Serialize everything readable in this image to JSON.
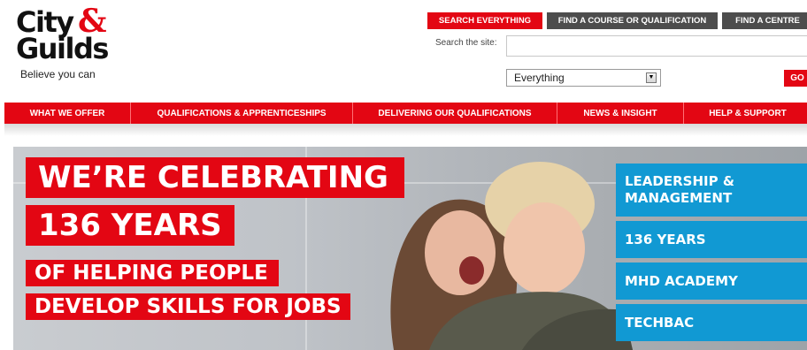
{
  "logo": {
    "line1": "City",
    "amp": "&",
    "line2": "Guilds",
    "tagline": "Believe you can"
  },
  "utility_tabs": [
    {
      "label": "SEARCH EVERYTHING",
      "active": true
    },
    {
      "label": "FIND A COURSE OR QUALIFICATION",
      "active": false
    },
    {
      "label": "FIND A CENTRE",
      "active": false
    }
  ],
  "search": {
    "label": "Search the site:",
    "value": "",
    "scope_selected": "Everything",
    "go_label": "GO"
  },
  "nav": [
    {
      "label": "WHAT WE OFFER"
    },
    {
      "label": "QUALIFICATIONS & APPRENTICESHIPS"
    },
    {
      "label": "DELIVERING OUR QUALIFICATIONS"
    },
    {
      "label": "NEWS & INSIGHT"
    },
    {
      "label": "HELP & SUPPORT"
    }
  ],
  "hero": {
    "line1": "WE’RE CELEBRATING",
    "line2": "136 YEARS",
    "line3": "OF HELPING PEOPLE",
    "line4": "DEVELOP SKILLS FOR JOBS"
  },
  "side_links": [
    {
      "line1": "LEADERSHIP &",
      "line2": "MANAGEMENT"
    },
    {
      "line1": "136 YEARS"
    },
    {
      "line1": "MHD ACADEMY"
    },
    {
      "line1": "TECHBAC"
    }
  ],
  "colors": {
    "brand_red": "#e30613",
    "nav_grey": "#4d4d4d",
    "side_blue": "#1199d3"
  }
}
